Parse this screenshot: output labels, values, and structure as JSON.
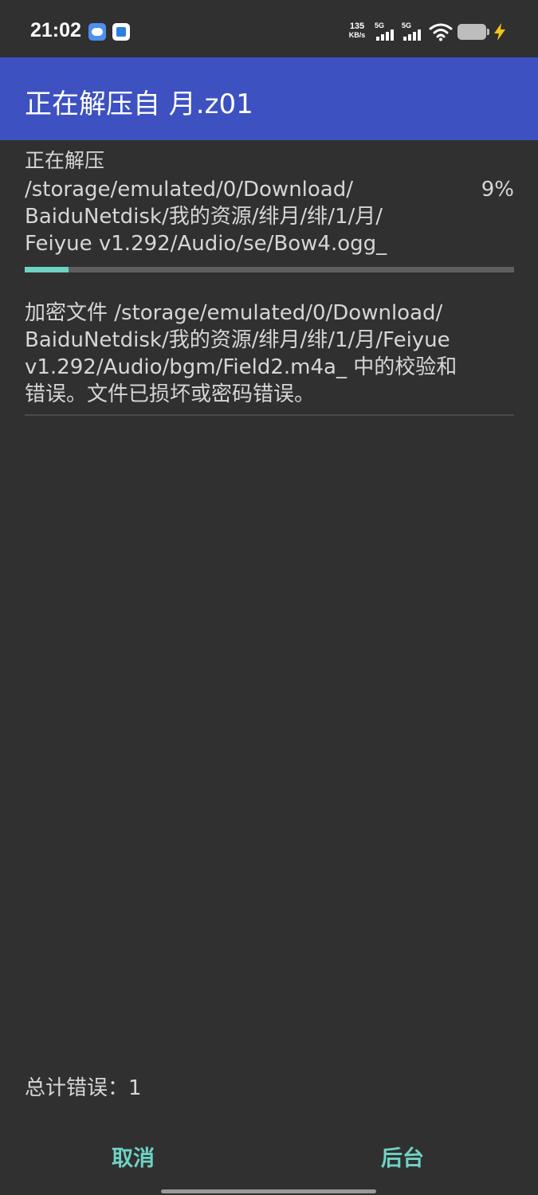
{
  "status_bar": {
    "time": "21:02",
    "net_speed_value": "135",
    "net_speed_unit": "KB/s",
    "signal_1_label": "5G",
    "signal_2_label": "5G"
  },
  "header": {
    "title": "正在解压自 月.z01"
  },
  "extraction": {
    "label": "正在解压",
    "path_lines": [
      "/storage/emulated/0/Download/",
      "BaiduNetdisk/我的资源/绯月/绯/1/月/",
      "Feiyue v1.292/Audio/se/Bow4.ogg_"
    ],
    "percent_text": "9%",
    "progress": 9
  },
  "error": {
    "message_lines": [
      "加密文件 /storage/emulated/0/Download/",
      "BaiduNetdisk/我的资源/绯月/绯/1/月/Feiyue",
      "v1.292/Audio/bgm/Field2.m4a_ 中的校验和",
      "错误。文件已损坏或密码错误。"
    ]
  },
  "footer": {
    "total_errors": "总计错误：1"
  },
  "actions": {
    "cancel_label": "取消",
    "background_label": "后台"
  },
  "colors": {
    "background": "#303030",
    "app_bar": "#3d51c0",
    "accent": "#6fd3c4",
    "track": "#5f5f5f",
    "text": "#d6d6d6"
  }
}
